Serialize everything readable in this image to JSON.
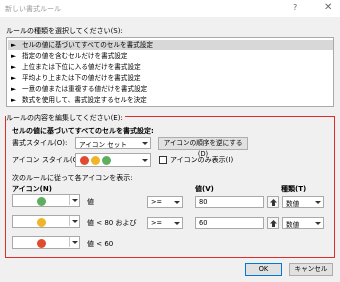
{
  "window": {
    "title": "新しい書式ルール",
    "help": "?",
    "close": "✕"
  },
  "rule_type": {
    "label": "ルールの種類を選択してください(S):",
    "items": [
      "セルの値に基づいてすべてのセルを書式設定",
      "指定の値を含むセルだけを書式設定",
      "上位または下位に入る値だけを書式設定",
      "平均より上または下の値だけを書式設定",
      "一意の値または重複する値だけを書式設定",
      "数式を使用して、書式設定するセルを決定"
    ],
    "selected_index": 0
  },
  "rule_edit": {
    "label": "ルールの内容を編集してください(E):",
    "heading": "セルの値に基づいてすべてのセルを書式設定:",
    "format_style_label": "書式スタイル(O):",
    "format_style_value": "アイコン セット",
    "reverse_button": "アイコンの順序を逆にする(D)",
    "icon_style_label": "アイコン スタイル(C):",
    "icon_only_label": "アイコンのみ表示(I)",
    "icon_only_checked": false,
    "rules_label": "次のルールに従って各アイコンを表示:",
    "col_icon": "アイコン(N)",
    "col_value": "値(V)",
    "col_type": "種類(T)",
    "rows": [
      {
        "icon_color": "#5fae5f",
        "condition": "値",
        "operator": ">=",
        "value": "80",
        "type": "数値"
      },
      {
        "icon_color": "#f0b429",
        "condition": "値 < 80 および",
        "operator": ">=",
        "value": "60",
        "type": "数値"
      },
      {
        "icon_color": "#e04a2f",
        "condition": "値 < 60"
      }
    ]
  },
  "buttons": {
    "ok": "OK",
    "cancel": "キャンセル"
  },
  "colors": {
    "green": "#5fae5f",
    "yellow": "#f0b429",
    "red": "#e04a2f",
    "border_red": "#e02b2b",
    "selected_bg": "#d8d8d8"
  }
}
